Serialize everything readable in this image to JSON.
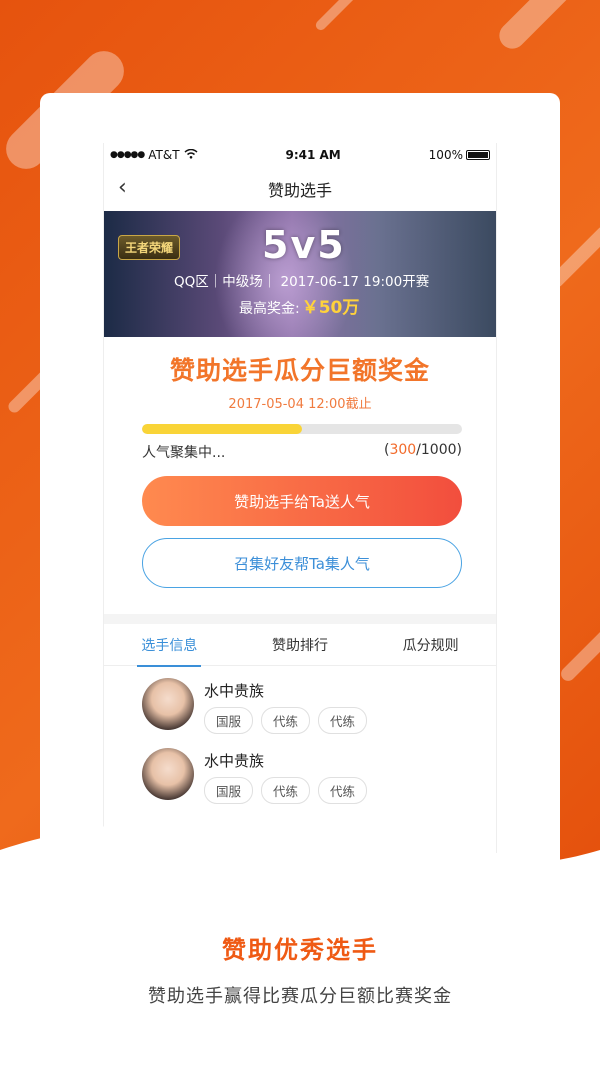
{
  "status": {
    "carrier": "AT&T",
    "time": "9:41 AM",
    "battery": "100%"
  },
  "nav": {
    "title": "赞助选手"
  },
  "banner": {
    "game": "王者荣耀",
    "mode": "5v5",
    "info": "QQ区｜中级场｜ 2017-06-17 19:00开赛",
    "prize_label": "最高奖金:",
    "prize_value": "￥50万"
  },
  "promo": {
    "title": "赞助选手瓜分巨额奖金",
    "deadline": "2017-05-04 12:00截止"
  },
  "progress": {
    "label": "人气聚集中...",
    "current": "300",
    "total": "1000",
    "open": "(",
    "sep": "/",
    "close": ")",
    "fraction": 0.5
  },
  "buttons": {
    "primary": "赞助选手给Ta送人气",
    "secondary": "召集好友帮Ta集人气"
  },
  "tabs": [
    {
      "label": "选手信息",
      "active": true
    },
    {
      "label": "赞助排行",
      "active": false
    },
    {
      "label": "瓜分规则",
      "active": false
    }
  ],
  "players": [
    {
      "name": "水中贵族",
      "tags": [
        "国服",
        "代练",
        "代练"
      ]
    },
    {
      "name": "水中贵族",
      "tags": [
        "国服",
        "代练",
        "代练"
      ]
    }
  ],
  "footer": {
    "title": "赞助优秀选手",
    "subtitle": "赞助选手赢得比赛瓜分巨额比赛奖金"
  }
}
